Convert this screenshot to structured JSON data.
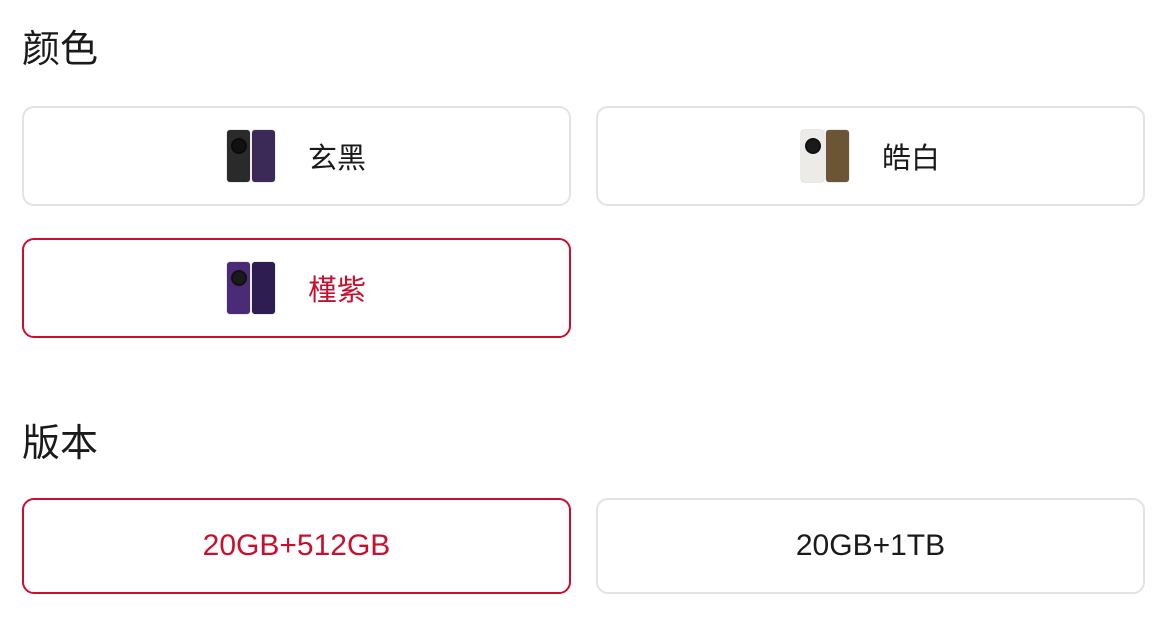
{
  "color_section": {
    "title": "颜色",
    "options": [
      {
        "label": "玄黑",
        "selected": false,
        "swatch_back": "#2a2a2a",
        "swatch_front": "#3b2a57",
        "cam": "#111111"
      },
      {
        "label": "皓白",
        "selected": false,
        "swatch_back": "#ecebe8",
        "swatch_front": "#6b5535",
        "cam": "#1a1a1a"
      },
      {
        "label": "槿紫",
        "selected": true,
        "swatch_back": "#4b2a78",
        "swatch_front": "#2e1d50",
        "cam": "#1a1a1a"
      }
    ]
  },
  "version_section": {
    "title": "版本",
    "options": [
      {
        "label": "20GB+512GB",
        "selected": true
      },
      {
        "label": "20GB+1TB",
        "selected": false
      }
    ]
  },
  "colors": {
    "accent": "#c8102e",
    "border": "#e3e3e3"
  }
}
